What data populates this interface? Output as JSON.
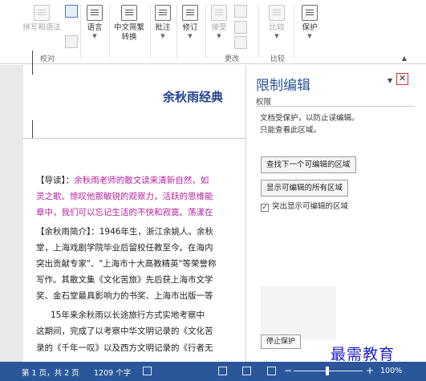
{
  "ribbon": {
    "buttons": [
      {
        "label": "拼写和语法",
        "disabled": true
      },
      {
        "label": "语言",
        "caret": true
      },
      {
        "label": "中文简繁",
        "label2": "转换",
        "caret": true
      },
      {
        "label": "批注",
        "caret": true
      },
      {
        "label": "修订",
        "caret": true
      },
      {
        "label": "接受",
        "caret": true,
        "disabled": true
      },
      {
        "label": "比较",
        "caret": true,
        "disabled": true
      },
      {
        "label": "保护",
        "caret": true
      }
    ],
    "groups": [
      "校对",
      "更改",
      "比较"
    ]
  },
  "document": {
    "title": "余秋雨经典",
    "paragraphs": [
      {
        "prefix": "【导读】：",
        "text": "余秋雨老师的散文读来清新自然，如"
      },
      {
        "text": "灵之歌。惊叹他那敏锐的观察力，活跃的思维能"
      },
      {
        "text": "章中，我们可以忘记生活的不快和寂寞。荡漾在"
      },
      {
        "prefix": "【余秋雨简介】",
        "text": "：1946年生，浙江余姚人。余秋"
      },
      {
        "text": "堂，上海戏剧学院毕业后留校任教至今。在海内"
      },
      {
        "text": "突出贡献专家\"、\"上海市十大高教精英\"等荣誉称"
      },
      {
        "text": "写作。其散文集《文化苦旅》先后获上海市文学"
      },
      {
        "text": "奖、金石堂最具影响力的书奖、上海市出版一等"
      },
      {
        "text": "15年来余秋雨以长途旅行方式实地考察中"
      },
      {
        "text": "这期间，完成了以考察中华文明记录的《文化苦"
      },
      {
        "text": "录的《千年一叹》以及西方文明记录的《行者无"
      }
    ]
  },
  "pane": {
    "title": "限制编辑",
    "section": "权限",
    "lines": [
      "文档受保护，以防止误编辑。",
      "只能查看此区域。"
    ],
    "find_next": "查找下一个可编辑的区域",
    "show_all": "显示可编辑的所有区域",
    "highlight": "突出显示可编辑的区域",
    "highlight_checked": true,
    "stop": "停止保护"
  },
  "watermark": "最需教育",
  "status": {
    "page": "第 1 页，共 2 页",
    "words": "1209 个字",
    "zoom": "100%"
  },
  "colors": {
    "accent": "#2b579a",
    "close_border": "#d32f2f",
    "purple_text": "#b3239e",
    "title_blue": "#1f3f8f"
  }
}
